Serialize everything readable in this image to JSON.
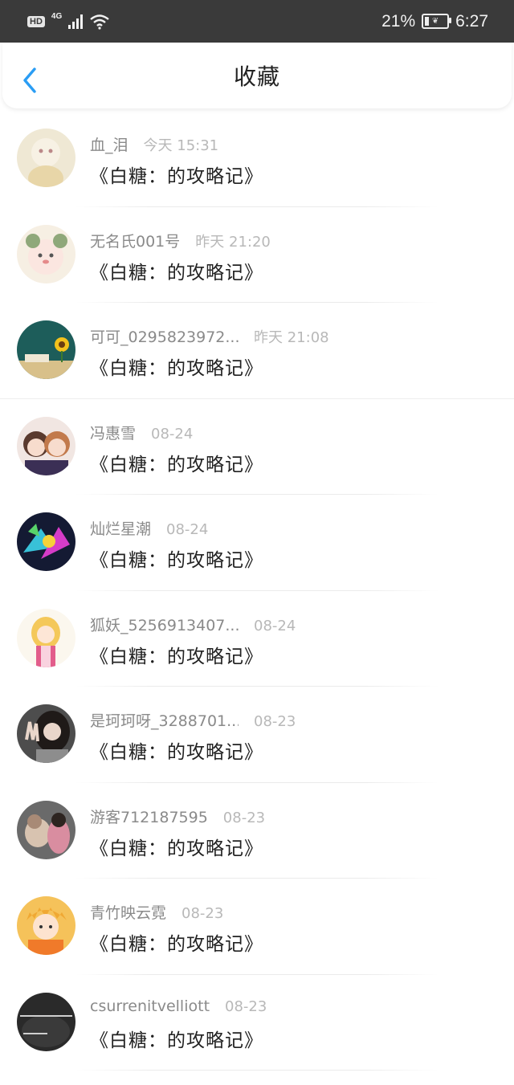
{
  "status_bar": {
    "hd": "HD",
    "network": "4G",
    "battery_percent": "21%",
    "battery_level": 0.21,
    "time": "6:27"
  },
  "header": {
    "title": "收藏",
    "back_icon": "chevron-left-icon",
    "accent_color": "#2a9df4"
  },
  "favorites": [
    {
      "name": "血_泪",
      "time": "今天 15:31",
      "work": "《白糖：的攻略记》"
    },
    {
      "name": "无名氏001号",
      "time": "昨天 21:20",
      "work": "《白糖：的攻略记》"
    },
    {
      "name": "可可_0295823972...",
      "time": "昨天 21:08",
      "work": "《白糖：的攻略记》"
    },
    {
      "name": "冯惠雪",
      "time": "08-24",
      "work": "《白糖：的攻略记》"
    },
    {
      "name": "灿烂星潮",
      "time": "08-24",
      "work": "《白糖：的攻略记》"
    },
    {
      "name": "狐妖_5256913407...",
      "time": "08-24",
      "work": "《白糖：的攻略记》"
    },
    {
      "name": "是珂珂呀_3288701...",
      "time": "08-23",
      "work": "《白糖：的攻略记》"
    },
    {
      "name": "游客712187595",
      "time": "08-23",
      "work": "《白糖：的攻略记》"
    },
    {
      "name": "青竹映云霓",
      "time": "08-23",
      "work": "《白糖：的攻略记》"
    },
    {
      "name": "csurrenitvelliott",
      "time": "08-23",
      "work": "《白糖：的攻略记》"
    }
  ]
}
